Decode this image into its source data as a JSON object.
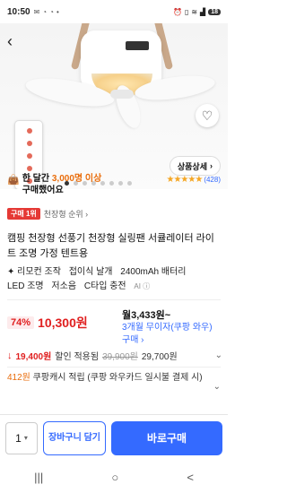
{
  "status_bar": {
    "time": "10:50",
    "left_icons": [
      "mail-icon",
      "chat-icon",
      "chat-icon",
      "dot-icon"
    ],
    "right_icons": [
      "alarm-icon",
      "vibrate-icon",
      "wifi-icon",
      "signal-icon"
    ],
    "battery": "18"
  },
  "hero": {
    "page_index": 0,
    "page_count": 8,
    "detail_button": "상품상세"
  },
  "social_proof": {
    "prefix": "한 달간 ",
    "count": "3,000명 이상",
    "suffix": "구매했어요",
    "stars": "★★★★★",
    "rating_value": 4.5,
    "review_count": "(428)"
  },
  "rank": {
    "badge": "구매 1위",
    "label": "천장형 순위 ›"
  },
  "product": {
    "title": "캠핑 천장형 선풍기 천장형 실링팬 서큘레이터 라이트 조명 가정 텐트용",
    "tags": [
      "✦ 리모컨 조작",
      "접이식 날개",
      "2400mAh 배터리",
      "LED 조명",
      "저소음",
      "C타입 충전"
    ],
    "ai_label": "AI ⓘ"
  },
  "price": {
    "discount": "74%",
    "sale_price": "10,300원",
    "monthly": "월3,433원~",
    "installment": "3개월 무이자(쿠팡 와우) 구매 ›"
  },
  "instant_discount": {
    "amount": "19,400원",
    "label": "할인 적용됨",
    "original_price": "39,900원",
    "final_price": "29,700원"
  },
  "cashback": {
    "amount": "412원",
    "text": " 쿠팡캐시 적립 (쿠팡 와우카드 일시불 결제 시)"
  },
  "bottom_bar": {
    "quantity": "1",
    "cart_label": "장바구니 담기",
    "buy_label": "바로구매"
  },
  "nav_bar": {
    "recent": "|||",
    "home": "○",
    "back": "<"
  }
}
